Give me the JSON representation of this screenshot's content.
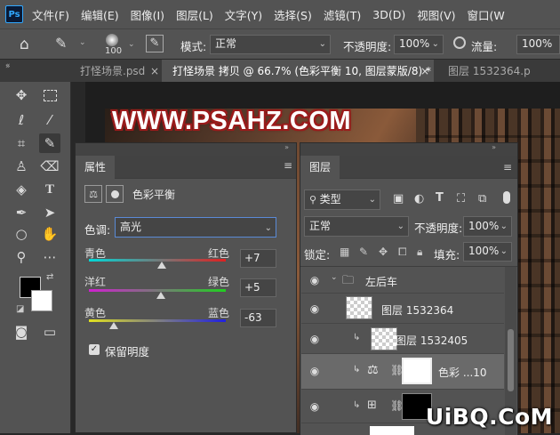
{
  "menubar": {
    "app_logo": "Ps",
    "items": [
      "文件(F)",
      "编辑(E)",
      "图像(I)",
      "图层(L)",
      "文字(Y)",
      "选择(S)",
      "滤镜(T)",
      "3D(D)",
      "视图(V)",
      "窗口(W"
    ]
  },
  "options": {
    "brush_size": "100",
    "mode_label": "模式:",
    "mode_value": "正常",
    "opacity_label": "不透明度:",
    "opacity_value": "100%",
    "flow_label": "流量:",
    "flow_value": "100%"
  },
  "tabs": [
    {
      "label": "打怪场景.psd",
      "close": "×"
    },
    {
      "label": "打怪场景 拷贝 @ 66.7% (色彩平衡 10, 图层蒙版/8) *",
      "close": "×"
    },
    {
      "label": "图层 1532364.p"
    }
  ],
  "canvas": {
    "banner_text": "WWW.PSAHZ.COM"
  },
  "properties": {
    "title": "属性",
    "adjustment_name": "色彩平衡",
    "tone_label": "色调:",
    "tone_value": "高光",
    "sliders": [
      {
        "left": "青色",
        "right": "红色",
        "value": "+7",
        "level": 7
      },
      {
        "left": "洋红",
        "right": "绿色",
        "value": "+5",
        "level": 5
      },
      {
        "left": "黄色",
        "right": "蓝色",
        "value": "-63",
        "level": -63
      }
    ],
    "preserve_label": "保留明度",
    "preserve_checked": true
  },
  "layers": {
    "title": "图层",
    "filter_kind": "类型",
    "blend_mode": "正常",
    "opacity_label": "不透明度:",
    "opacity_value": "100%",
    "lock_label": "锁定:",
    "fill_label": "填充:",
    "fill_value": "100%",
    "rows": [
      {
        "name": "左后车",
        "kind": "group"
      },
      {
        "name": "图层 1532364",
        "kind": "layer"
      },
      {
        "name": "图层 1532405",
        "kind": "layer"
      },
      {
        "name": "色彩 ...10",
        "kind": "adjustment"
      },
      {
        "name": "",
        "kind": "adjustment"
      }
    ]
  },
  "watermark": "UiBQ.CoM"
}
